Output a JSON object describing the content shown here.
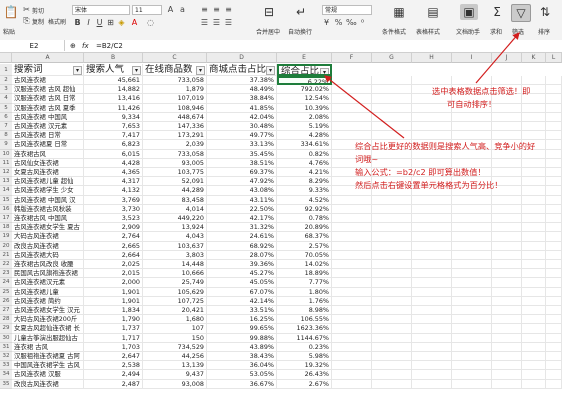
{
  "ribbon": {
    "paste": "粘贴",
    "cut": "剪切",
    "copy": "复制",
    "format_painter": "格式刷",
    "font_name": "宋体",
    "font_size": "11",
    "merge": "合并居中",
    "wrap": "自动换行",
    "number_format": "常规",
    "cond_format": "条件格式",
    "table_style": "表格样式",
    "doc_assist": "文档助手",
    "sum": "求和",
    "filter": "筛选",
    "sort": "排序"
  },
  "formula_bar": {
    "cell_ref": "E2",
    "fx": "fx",
    "formula": "=B2/C2"
  },
  "columns": [
    "A",
    "B",
    "C",
    "D",
    "E",
    "F",
    "G",
    "H",
    "I",
    "J",
    "K",
    "L"
  ],
  "table": {
    "headers": [
      "搜索词",
      "搜索人气",
      "在线商品数",
      "商城点击占比",
      "综合占比"
    ],
    "rows": [
      [
        "古风连衣裙",
        "45,661",
        "733,058",
        "37.38%",
        "6.22%"
      ],
      [
        "汉服连衣裙 古风 超仙",
        "14,882",
        "1,879",
        "48.49%",
        "792.02%"
      ],
      [
        "汉服连衣裙 古风 日常",
        "13,416",
        "107,019",
        "38.84%",
        "12.54%"
      ],
      [
        "汉服连衣裙 古风 夏季",
        "11,426",
        "108,946",
        "41.85%",
        "10.39%"
      ],
      [
        "古风连衣裙 中国风",
        "9,334",
        "448,674",
        "42.04%",
        "2.08%"
      ],
      [
        "古风连衣裙 汉元素",
        "7,653",
        "147,336",
        "30.48%",
        "5.19%"
      ],
      [
        "古风连衣裙 日常",
        "7,417",
        "173,291",
        "49.77%",
        "4.28%"
      ],
      [
        "古风连衣裙夏 日常",
        "6,823",
        "2,039",
        "33.13%",
        "334.61%"
      ],
      [
        "连衣裙古风",
        "6,015",
        "733,058",
        "35.45%",
        "0.82%"
      ],
      [
        "古风仙女连衣裙",
        "4,428",
        "93,005",
        "38.51%",
        "4.76%"
      ],
      [
        "女夏古风连衣裙",
        "4,365",
        "103,775",
        "69.37%",
        "4.21%"
      ],
      [
        "古风连衣裙儿童 超仙",
        "4,317",
        "52,091",
        "47.92%",
        "8.29%"
      ],
      [
        "古风连衣裙学生 少女",
        "4,132",
        "44,289",
        "43.08%",
        "9.33%"
      ],
      [
        "古风连衣裙 中国风 汉",
        "3,769",
        "83,458",
        "43.11%",
        "4.52%"
      ],
      [
        "韩版连衣裙古风秋装",
        "3,730",
        "4,014",
        "22.50%",
        "92.92%"
      ],
      [
        "连衣裙古风 中国风",
        "3,523",
        "449,220",
        "42.17%",
        "0.78%"
      ],
      [
        "古风连衣裙女学生 夏古",
        "2,909",
        "13,924",
        "31.32%",
        "20.89%"
      ],
      [
        "大码古风连衣裙",
        "2,764",
        "4,043",
        "24.61%",
        "68.37%"
      ],
      [
        "改良古风连衣裙",
        "2,665",
        "103,637",
        "68.92%",
        "2.57%"
      ],
      [
        "古风连衣裙大码",
        "2,664",
        "3,803",
        "28.07%",
        "70.05%"
      ],
      [
        "连衣裙古风改良 收腰",
        "2,025",
        "14,448",
        "39.36%",
        "14.02%"
      ],
      [
        "民国风古风旗袍连衣裙",
        "2,015",
        "10,666",
        "45.27%",
        "18.89%"
      ],
      [
        "古风连衣裙汉元素",
        "2,000",
        "25,749",
        "45.05%",
        "7.77%"
      ],
      [
        "古风连衣裙儿童",
        "1,901",
        "105,629",
        "67.07%",
        "1.80%"
      ],
      [
        "古风连衣裙 简约",
        "1,901",
        "107,725",
        "42.14%",
        "1.76%"
      ],
      [
        "古风连衣裙女学生 汉元",
        "1,834",
        "20,421",
        "33.51%",
        "8.98%"
      ],
      [
        "大码古风连衣裙200斤",
        "1,790",
        "1,680",
        "16.25%",
        "106.55%"
      ],
      [
        "女夏古风超仙连衣裙 长",
        "1,737",
        "107",
        "99.65%",
        "1623.36%"
      ],
      [
        "儿童古筝演出服超仙古",
        "1,717",
        "150",
        "99.88%",
        "1144.67%"
      ],
      [
        "连衣裙 古风",
        "1,703",
        "734,529",
        "43.89%",
        "0.23%"
      ],
      [
        "汉服祖袍连衣裙夏 古阿",
        "2,647",
        "44,256",
        "38.43%",
        "5.98%"
      ],
      [
        "中国风连衣裙学生 古风",
        "2,538",
        "13,139",
        "36.04%",
        "19.32%"
      ],
      [
        "古风连衣裙 汉服",
        "2,494",
        "9,437",
        "53.05%",
        "26.43%"
      ],
      [
        "改良古风连衣裙",
        "2,487",
        "93,008",
        "36.67%",
        "2.67%"
      ]
    ]
  },
  "notes": {
    "filter_tip": [
      "选中表格数据点击筛选！即",
      "可自动排序！"
    ],
    "formula_tip": [
      "综合占比更好的数据则是搜索人气高、竞争小的好",
      "词哦~",
      "输入公式：=b2/c2 即可算出数值！",
      "然后点击右键设置单元格格式为百分比！"
    ]
  },
  "colors": {
    "annotation": "#d21e1e",
    "active_border": "#1e7d3b"
  }
}
